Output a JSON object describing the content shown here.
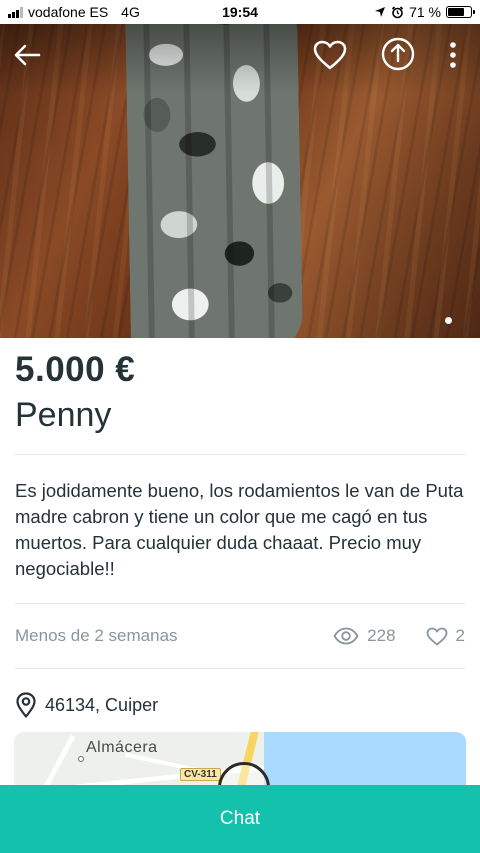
{
  "status_bar": {
    "carrier": "vodafone ES",
    "network": "4G",
    "time": "19:54",
    "battery_percent": "71 %",
    "battery_level": 0.71
  },
  "toolbar": {
    "back_icon": "arrow-left-icon",
    "favorite_icon": "heart-icon",
    "share_icon": "share-icon",
    "more_icon": "more-vertical-icon"
  },
  "listing": {
    "price": "5.000 €",
    "title": "Penny",
    "description": "Es jodidamente bueno, los rodamientos le van de Puta madre cabron y tiene un color que me cagó en tus muertos. Para cualquier duda chaaat. Precio muy negociable!!",
    "posted": "Menos de 2 semanas",
    "views": "228",
    "likes": "2",
    "location": "46134, Cuiper"
  },
  "map": {
    "place_label": "Almácera",
    "road_label": "CV-311"
  },
  "chat": {
    "label": "Chat"
  },
  "colors": {
    "accent": "#13c1ac",
    "text": "#253238",
    "muted": "#8a959c"
  }
}
